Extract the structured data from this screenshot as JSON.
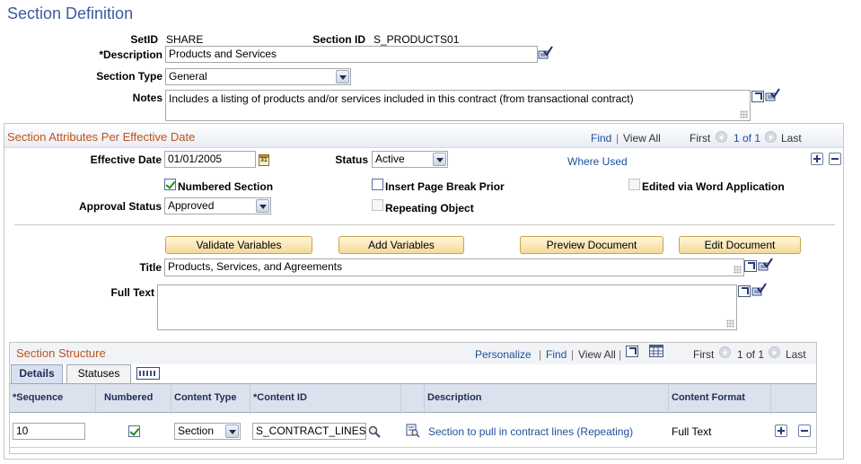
{
  "page": {
    "title": "Section Definition"
  },
  "header": {
    "setid_label": "SetID",
    "setid_value": "SHARE",
    "section_id_label": "Section ID",
    "section_id_value": "S_PRODUCTS01",
    "description_label": "*Description",
    "description_value": "Products and Services",
    "section_type_label": "Section Type",
    "section_type_value": "General",
    "notes_label": "Notes",
    "notes_value": "Includes a listing of products and/or services included in this contract (from transactional contract)"
  },
  "attributes": {
    "title": "Section Attributes Per Effective Date",
    "nav": {
      "find": "Find",
      "view_all": "View All",
      "first": "First",
      "count": "1 of 1",
      "last": "Last"
    },
    "effective_date_label": "Effective Date",
    "effective_date_value": "01/01/2005",
    "status_label": "Status",
    "status_value": "Active",
    "where_used": "Where Used",
    "numbered_section": "Numbered Section",
    "numbered_section_checked": true,
    "insert_page_break": "Insert Page Break Prior",
    "edited_via_word": "Edited via Word Application",
    "approval_status_label": "Approval Status",
    "approval_status_value": "Approved",
    "repeating_object": "Repeating Object",
    "buttons": {
      "validate": "Validate Variables",
      "add": "Add Variables",
      "preview": "Preview Document",
      "edit": "Edit Document"
    },
    "title_label": "Title",
    "title_value": "Products,  Services, and Agreements",
    "full_text_label": "Full Text",
    "full_text_value": ""
  },
  "structure": {
    "title": "Section Structure",
    "nav": {
      "personalize": "Personalize",
      "find": "Find",
      "view_all": "View All",
      "first": "First",
      "count": "1 of 1",
      "last": "Last"
    },
    "tabs": [
      "Details",
      "Statuses"
    ],
    "columns": [
      "*Sequence",
      "Numbered",
      "Content Type",
      "*Content ID",
      "Description",
      "Content Format"
    ],
    "rows": [
      {
        "sequence": "10",
        "numbered": true,
        "content_type": "Section",
        "content_id": "S_CONTRACT_LINES",
        "description": "Section to pull in contract lines (Repeating)",
        "content_format": "Full Text"
      }
    ]
  }
}
